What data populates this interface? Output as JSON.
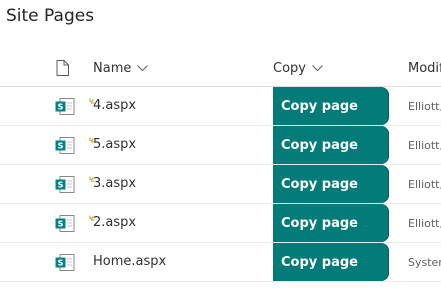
{
  "page": {
    "title": "Site Pages"
  },
  "columns": {
    "name": "Name",
    "copy": "Copy",
    "modified": "Modif"
  },
  "rows": [
    {
      "name": "4.aspx",
      "copy_label": "Copy page",
      "modified_by": "Elliott,",
      "is_new": true
    },
    {
      "name": "5.aspx",
      "copy_label": "Copy page",
      "modified_by": "Elliott,",
      "is_new": true
    },
    {
      "name": "3.aspx",
      "copy_label": "Copy page",
      "modified_by": "Elliott,",
      "is_new": true
    },
    {
      "name": "2.aspx",
      "copy_label": "Copy page",
      "modified_by": "Elliott,",
      "is_new": true
    },
    {
      "name": "Home.aspx",
      "copy_label": "Copy page",
      "modified_by": "System",
      "is_new": false
    }
  ],
  "colors": {
    "copy_button_bg": "#037b78",
    "file_icon_accent": "#038387",
    "new_mark": "#c19c00"
  },
  "icons": {
    "doc_header": "document-icon",
    "file": "sharepoint-page-icon",
    "new": "new-item-icon",
    "sort": "chevron-down-icon"
  }
}
